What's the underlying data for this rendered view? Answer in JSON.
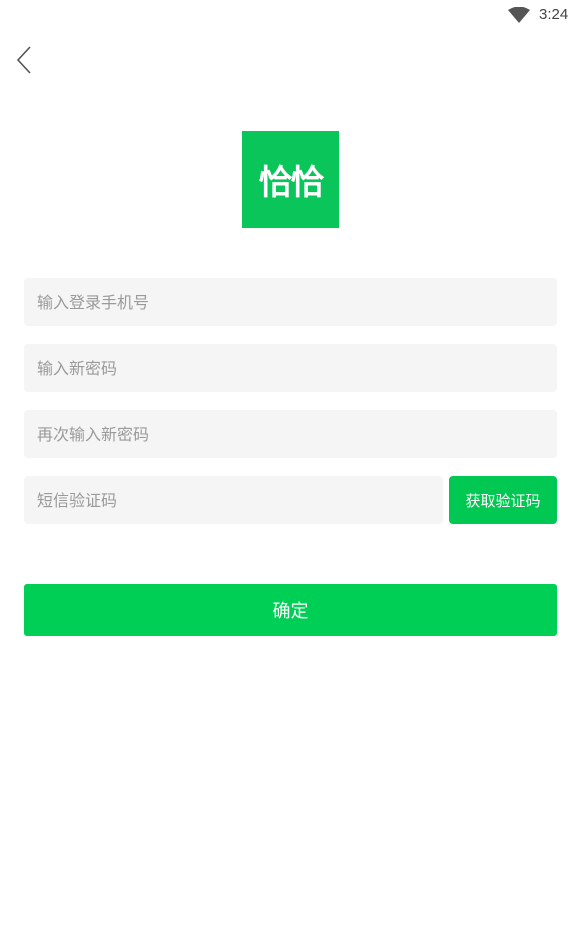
{
  "status_bar": {
    "time": "3:24",
    "wifi_icon": "wifi-icon"
  },
  "header": {
    "back_icon": "chevron-left-icon"
  },
  "logo": {
    "text": "恰恰",
    "color": "#09c55a"
  },
  "form": {
    "phone_placeholder": "输入登录手机号",
    "phone_value": "",
    "new_password_placeholder": "输入新密码",
    "new_password_value": "",
    "confirm_password_placeholder": "再次输入新密码",
    "confirm_password_value": "",
    "sms_code_placeholder": "短信验证码",
    "sms_code_value": "",
    "get_code_label": "获取验证码",
    "submit_label": "确定"
  },
  "colors": {
    "accent": "#00c853",
    "field_bg": "#f5f5f5",
    "placeholder": "#9a9a9a"
  }
}
